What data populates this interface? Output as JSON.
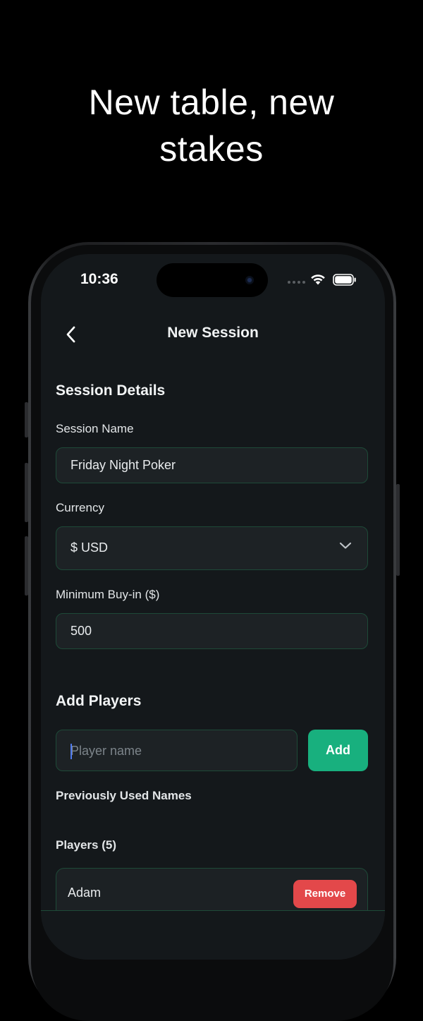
{
  "headline": {
    "line1": "New table, new",
    "line2": "stakes"
  },
  "status_bar": {
    "time": "10:36"
  },
  "nav": {
    "title": "New Session"
  },
  "session_details": {
    "title": "Session Details",
    "session_name": {
      "label": "Session Name",
      "value": "Friday Night Poker"
    },
    "currency": {
      "label": "Currency",
      "value": "$ USD"
    },
    "min_buyin": {
      "label": "Minimum Buy-in ($)",
      "value": "500"
    }
  },
  "add_players": {
    "title": "Add Players",
    "input_placeholder": "Player name",
    "add_label": "Add",
    "previously_used_label": "Previously Used Names"
  },
  "players": {
    "title": "Players (5)",
    "items": [
      {
        "name": "Adam",
        "remove_label": "Remove"
      }
    ]
  },
  "colors": {
    "accent_green": "#18b07e",
    "remove_red": "#e3484a",
    "field_border": "#1e4a38",
    "screen_bg": "#14181b"
  }
}
